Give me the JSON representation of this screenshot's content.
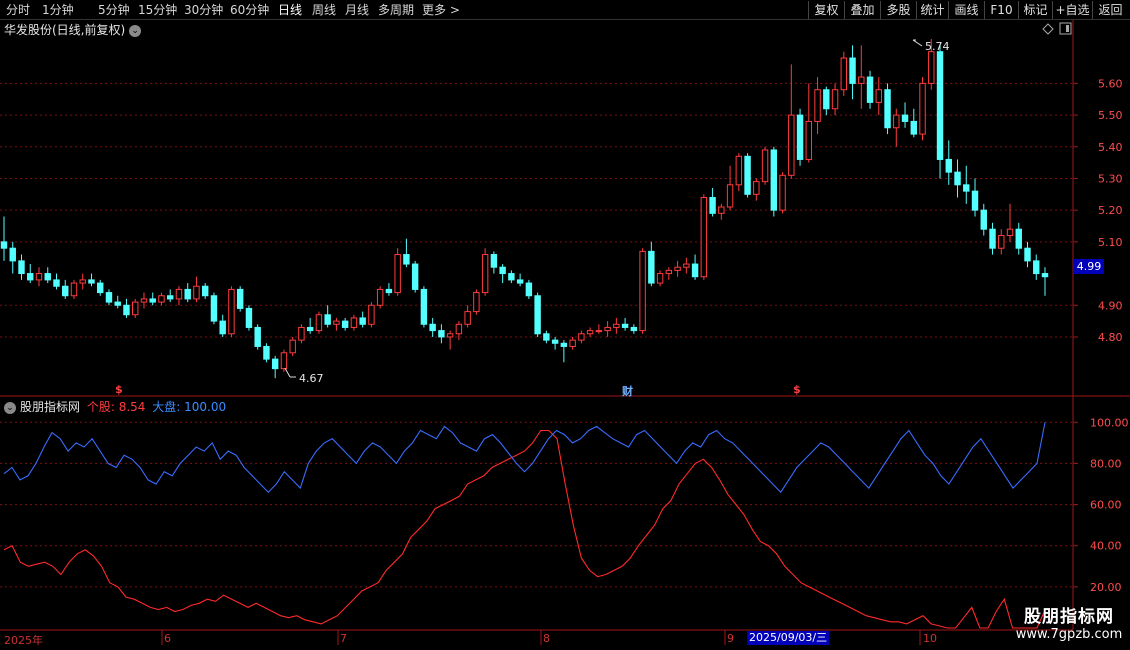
{
  "toolbar": {
    "periods": [
      "分时",
      "1分钟",
      "5分钟",
      "15分钟",
      "30分钟",
      "60分钟",
      "日线",
      "周线",
      "月线",
      "多周期",
      "更多 >"
    ],
    "active_period": "日线",
    "right_buttons": [
      "复权",
      "叠加",
      "多股",
      "统计",
      "画线",
      "F10",
      "标记",
      "+自选",
      "返回"
    ]
  },
  "main_chart": {
    "title": "华发股份(日线,前复权)",
    "price_axis_labels": [
      "5.60",
      "5.50",
      "5.40",
      "5.30",
      "5.20",
      "5.10",
      "4.90",
      "4.80"
    ],
    "current_price": "4.99",
    "high_marker": "5.74",
    "low_marker": "4.67",
    "event_markers": [
      {
        "text": "$",
        "color": "#ff4040"
      },
      {
        "text": "财",
        "color": "#6fb2ff"
      },
      {
        "text": "$",
        "color": "#ff4040"
      }
    ]
  },
  "indicator": {
    "name": "股朋指标网",
    "stock_label": "个股:",
    "stock_value": "8.54",
    "market_label": "大盘:",
    "market_value": "100.00",
    "axis_labels": [
      "100.00",
      "80.00",
      "60.00",
      "40.00",
      "20.00"
    ]
  },
  "time_axis": {
    "labels": [
      "2025年",
      "6",
      "7",
      "8",
      "9",
      "10"
    ],
    "cursor_date": "2025/09/03/三"
  },
  "watermark": {
    "title": "股朋指标网",
    "url": "www.7gpzb.com"
  },
  "colors": {
    "up": "#ff3c3c",
    "down": "#54ffff",
    "grid": "#7a1010",
    "axis": "#a01818",
    "market_line": "#3a6cff",
    "stock_line": "#ff2a2a"
  },
  "chart_data": [
    {
      "type": "candlestick",
      "title": "华发股份(日线,前复权)",
      "ylim": [
        4.67,
        5.74
      ],
      "x_range": [
        "2025-05",
        "2025-10"
      ],
      "highlighted": {
        "high": 5.74,
        "low": 4.67,
        "last": 4.99
      },
      "ohlc": [
        [
          5.1,
          5.18,
          5.04,
          5.08
        ],
        [
          5.08,
          5.1,
          5.0,
          5.04
        ],
        [
          5.04,
          5.06,
          4.98,
          5.0
        ],
        [
          5.0,
          5.03,
          4.97,
          4.98
        ],
        [
          4.98,
          5.02,
          4.96,
          5.0
        ],
        [
          5.0,
          5.02,
          4.97,
          4.98
        ],
        [
          4.98,
          5.0,
          4.95,
          4.96
        ],
        [
          4.96,
          4.98,
          4.92,
          4.93
        ],
        [
          4.93,
          4.98,
          4.92,
          4.97
        ],
        [
          4.97,
          5.0,
          4.95,
          4.98
        ],
        [
          4.98,
          5.0,
          4.96,
          4.97
        ],
        [
          4.97,
          4.98,
          4.93,
          4.94
        ],
        [
          4.94,
          4.95,
          4.9,
          4.91
        ],
        [
          4.91,
          4.93,
          4.89,
          4.9
        ],
        [
          4.9,
          4.92,
          4.86,
          4.87
        ],
        [
          4.87,
          4.92,
          4.86,
          4.91
        ],
        [
          4.91,
          4.94,
          4.89,
          4.92
        ],
        [
          4.92,
          4.94,
          4.9,
          4.91
        ],
        [
          4.91,
          4.94,
          4.9,
          4.93
        ],
        [
          4.93,
          4.95,
          4.91,
          4.92
        ],
        [
          4.92,
          4.96,
          4.9,
          4.95
        ],
        [
          4.95,
          4.97,
          4.91,
          4.92
        ],
        [
          4.92,
          4.99,
          4.91,
          4.96
        ],
        [
          4.96,
          4.97,
          4.92,
          4.93
        ],
        [
          4.93,
          4.94,
          4.84,
          4.85
        ],
        [
          4.85,
          4.87,
          4.8,
          4.81
        ],
        [
          4.81,
          4.96,
          4.8,
          4.95
        ],
        [
          4.95,
          4.96,
          4.88,
          4.89
        ],
        [
          4.89,
          4.9,
          4.82,
          4.83
        ],
        [
          4.83,
          4.84,
          4.76,
          4.77
        ],
        [
          4.77,
          4.78,
          4.72,
          4.73
        ],
        [
          4.73,
          4.74,
          4.67,
          4.7
        ],
        [
          4.7,
          4.76,
          4.69,
          4.75
        ],
        [
          4.75,
          4.8,
          4.74,
          4.79
        ],
        [
          4.79,
          4.84,
          4.78,
          4.83
        ],
        [
          4.83,
          4.86,
          4.81,
          4.82
        ],
        [
          4.82,
          4.88,
          4.81,
          4.87
        ],
        [
          4.87,
          4.9,
          4.83,
          4.84
        ],
        [
          4.84,
          4.86,
          4.82,
          4.85
        ],
        [
          4.85,
          4.86,
          4.82,
          4.83
        ],
        [
          4.83,
          4.87,
          4.82,
          4.86
        ],
        [
          4.86,
          4.88,
          4.83,
          4.84
        ],
        [
          4.84,
          4.91,
          4.83,
          4.9
        ],
        [
          4.9,
          4.96,
          4.89,
          4.95
        ],
        [
          4.95,
          4.97,
          4.93,
          4.94
        ],
        [
          4.94,
          5.08,
          4.93,
          5.06
        ],
        [
          5.06,
          5.11,
          5.02,
          5.03
        ],
        [
          5.03,
          5.04,
          4.94,
          4.95
        ],
        [
          4.95,
          4.96,
          4.83,
          4.84
        ],
        [
          4.84,
          4.86,
          4.8,
          4.82
        ],
        [
          4.82,
          4.84,
          4.78,
          4.8
        ],
        [
          4.8,
          4.82,
          4.76,
          4.81
        ],
        [
          4.81,
          4.85,
          4.79,
          4.84
        ],
        [
          4.84,
          4.9,
          4.83,
          4.88
        ],
        [
          4.88,
          4.95,
          4.87,
          4.94
        ],
        [
          4.94,
          5.08,
          4.93,
          5.06
        ],
        [
          5.06,
          5.07,
          5.0,
          5.02
        ],
        [
          5.02,
          5.03,
          4.97,
          5.0
        ],
        [
          5.0,
          5.01,
          4.97,
          4.98
        ],
        [
          4.98,
          5.0,
          4.96,
          4.97
        ],
        [
          4.97,
          4.98,
          4.92,
          4.93
        ],
        [
          4.93,
          4.94,
          4.8,
          4.81
        ],
        [
          4.81,
          4.82,
          4.78,
          4.79
        ],
        [
          4.79,
          4.8,
          4.76,
          4.78
        ],
        [
          4.78,
          4.79,
          4.72,
          4.77
        ],
        [
          4.77,
          4.8,
          4.76,
          4.79
        ],
        [
          4.79,
          4.82,
          4.78,
          4.81
        ],
        [
          4.81,
          4.83,
          4.8,
          4.82
        ],
        [
          4.82,
          4.84,
          4.81,
          4.82
        ],
        [
          4.82,
          4.85,
          4.8,
          4.83
        ],
        [
          4.83,
          4.86,
          4.81,
          4.84
        ],
        [
          4.84,
          4.86,
          4.82,
          4.83
        ],
        [
          4.83,
          4.84,
          4.81,
          4.82
        ],
        [
          4.82,
          5.08,
          4.81,
          5.07
        ],
        [
          5.07,
          5.1,
          4.96,
          4.97
        ],
        [
          4.97,
          5.01,
          4.96,
          5.0
        ],
        [
          5.0,
          5.02,
          4.98,
          5.01
        ],
        [
          5.01,
          5.04,
          4.99,
          5.02
        ],
        [
          5.02,
          5.05,
          5.0,
          5.03
        ],
        [
          5.03,
          5.06,
          4.98,
          4.99
        ],
        [
          4.99,
          5.25,
          4.98,
          5.24
        ],
        [
          5.24,
          5.27,
          5.18,
          5.19
        ],
        [
          5.19,
          5.22,
          5.17,
          5.21
        ],
        [
          5.21,
          5.34,
          5.2,
          5.28
        ],
        [
          5.28,
          5.38,
          5.26,
          5.37
        ],
        [
          5.37,
          5.38,
          5.24,
          5.25
        ],
        [
          5.25,
          5.3,
          5.23,
          5.29
        ],
        [
          5.29,
          5.4,
          5.28,
          5.39
        ],
        [
          5.39,
          5.4,
          5.18,
          5.2
        ],
        [
          5.2,
          5.32,
          5.19,
          5.31
        ],
        [
          5.31,
          5.66,
          5.3,
          5.5
        ],
        [
          5.5,
          5.52,
          5.34,
          5.36
        ],
        [
          5.36,
          5.6,
          5.35,
          5.48
        ],
        [
          5.48,
          5.62,
          5.44,
          5.58
        ],
        [
          5.58,
          5.59,
          5.5,
          5.52
        ],
        [
          5.52,
          5.6,
          5.5,
          5.58
        ],
        [
          5.58,
          5.7,
          5.56,
          5.68
        ],
        [
          5.68,
          5.72,
          5.55,
          5.6
        ],
        [
          5.6,
          5.72,
          5.52,
          5.62
        ],
        [
          5.62,
          5.64,
          5.52,
          5.54
        ],
        [
          5.54,
          5.62,
          5.5,
          5.58
        ],
        [
          5.58,
          5.6,
          5.44,
          5.46
        ],
        [
          5.46,
          5.52,
          5.4,
          5.5
        ],
        [
          5.5,
          5.54,
          5.46,
          5.48
        ],
        [
          5.48,
          5.52,
          5.43,
          5.44
        ],
        [
          5.44,
          5.62,
          5.42,
          5.6
        ],
        [
          5.6,
          5.74,
          5.58,
          5.7
        ],
        [
          5.7,
          5.72,
          5.3,
          5.36
        ],
        [
          5.36,
          5.42,
          5.28,
          5.32
        ],
        [
          5.32,
          5.36,
          5.24,
          5.28
        ],
        [
          5.28,
          5.34,
          5.22,
          5.26
        ],
        [
          5.26,
          5.3,
          5.18,
          5.2
        ],
        [
          5.2,
          5.22,
          5.12,
          5.14
        ],
        [
          5.14,
          5.16,
          5.06,
          5.08
        ],
        [
          5.08,
          5.14,
          5.06,
          5.12
        ],
        [
          5.12,
          5.22,
          5.1,
          5.14
        ],
        [
          5.14,
          5.16,
          5.06,
          5.08
        ],
        [
          5.08,
          5.1,
          5.02,
          5.04
        ],
        [
          5.04,
          5.06,
          4.98,
          5.0
        ],
        [
          5.0,
          5.02,
          4.93,
          4.99
        ]
      ]
    },
    {
      "type": "line",
      "title": "股朋指标网",
      "ylim": [
        0,
        100
      ],
      "yticks": [
        100,
        80,
        60,
        40,
        20
      ],
      "series": [
        {
          "name": "个股",
          "last": 8.54,
          "values": [
            38,
            40,
            32,
            30,
            31,
            32,
            30,
            26,
            32,
            36,
            38,
            35,
            30,
            22,
            20,
            15,
            14,
            12,
            10,
            9,
            10,
            8,
            9,
            11,
            12,
            14,
            13,
            16,
            14,
            12,
            10,
            12,
            10,
            8,
            6,
            5,
            6,
            4,
            3,
            2,
            4,
            6,
            10,
            14,
            18,
            20,
            22,
            28,
            32,
            36,
            44,
            48,
            52,
            58,
            60,
            62,
            64,
            70,
            72,
            74,
            78,
            80,
            82,
            84,
            86,
            90,
            96,
            96,
            92,
            70,
            50,
            34,
            28,
            25,
            26,
            28,
            30,
            34,
            40,
            45,
            50,
            58,
            62,
            70,
            75,
            80,
            82,
            78,
            72,
            65,
            60,
            55,
            48,
            42,
            40,
            36,
            30,
            26,
            22,
            20,
            18,
            16,
            14,
            12,
            10,
            8,
            6,
            5,
            4,
            3,
            3,
            2,
            4,
            6,
            2,
            1,
            0,
            0,
            5,
            10,
            0,
            0,
            8,
            14,
            0,
            0,
            0,
            0,
            8.54
          ]
        },
        {
          "name": "大盘",
          "last": 100.0,
          "values": [
            75,
            78,
            72,
            74,
            80,
            88,
            95,
            92,
            86,
            90,
            88,
            92,
            86,
            80,
            78,
            84,
            82,
            78,
            72,
            70,
            76,
            74,
            80,
            84,
            88,
            86,
            90,
            82,
            86,
            84,
            78,
            74,
            70,
            66,
            70,
            76,
            72,
            68,
            80,
            86,
            90,
            92,
            88,
            84,
            80,
            86,
            90,
            88,
            84,
            80,
            86,
            90,
            96,
            94,
            92,
            98,
            95,
            90,
            88,
            86,
            92,
            94,
            90,
            85,
            80,
            76,
            80,
            86,
            92,
            96,
            94,
            90,
            92,
            96,
            98,
            95,
            92,
            90,
            88,
            94,
            96,
            92,
            88,
            84,
            80,
            86,
            90,
            88,
            94,
            96,
            92,
            90,
            86,
            82,
            78,
            74,
            70,
            66,
            72,
            78,
            82,
            86,
            90,
            88,
            84,
            80,
            76,
            72,
            68,
            74,
            80,
            86,
            92,
            96,
            90,
            84,
            80,
            74,
            70,
            76,
            82,
            88,
            92,
            86,
            80,
            74,
            68,
            72,
            76,
            80,
            100
          ]
        }
      ]
    }
  ]
}
